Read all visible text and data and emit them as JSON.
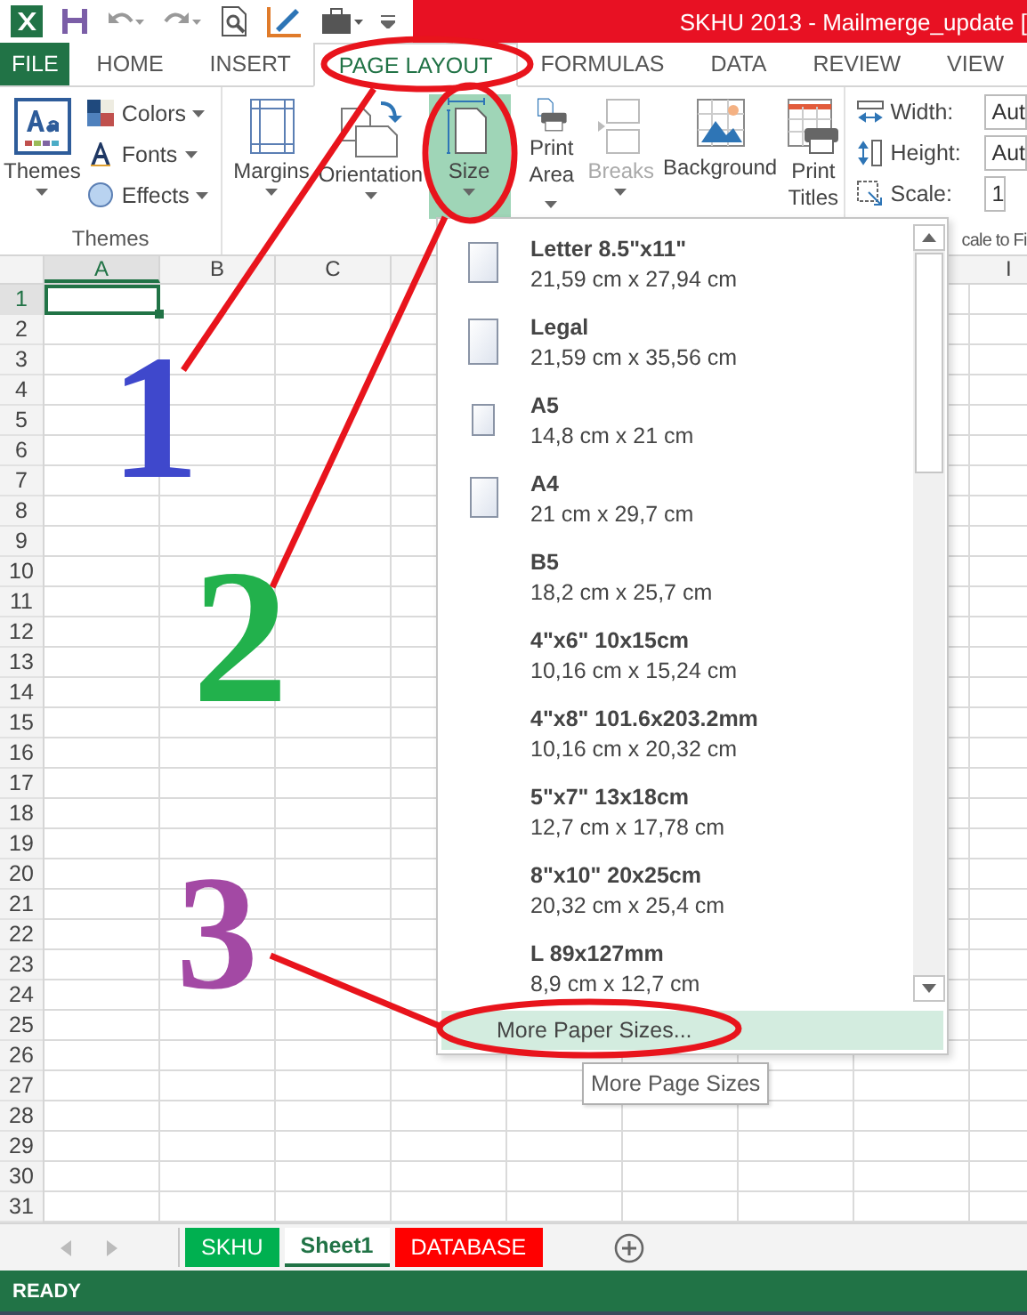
{
  "window": {
    "title": "SKHU 2013 - Mailmerge_update ["
  },
  "tabs": [
    {
      "label": "FILE",
      "kind": "file",
      "selected": false
    },
    {
      "label": "HOME",
      "kind": "tab",
      "selected": false
    },
    {
      "label": "INSERT",
      "kind": "tab",
      "selected": false
    },
    {
      "label": "PAGE LAYOUT",
      "kind": "tab",
      "selected": true
    },
    {
      "label": "FORMULAS",
      "kind": "tab",
      "selected": false
    },
    {
      "label": "DATA",
      "kind": "tab",
      "selected": false
    },
    {
      "label": "REVIEW",
      "kind": "tab",
      "selected": false
    },
    {
      "label": "VIEW",
      "kind": "tab",
      "selected": false
    }
  ],
  "ribbon": {
    "themes_group": {
      "title": "Themes",
      "big_button": {
        "label": "Themes"
      },
      "small_buttons": [
        {
          "label": "Colors"
        },
        {
          "label": "Fonts"
        },
        {
          "label": "Effects"
        }
      ]
    },
    "page_setup_buttons": [
      {
        "label": "Margins",
        "selected": false,
        "disabled": false
      },
      {
        "label": "Orientation",
        "selected": false,
        "disabled": false
      },
      {
        "label": "Size",
        "selected": true,
        "disabled": false
      },
      {
        "label": "Print Area",
        "selected": false,
        "disabled": false
      },
      {
        "label": "Breaks",
        "selected": false,
        "disabled": true
      },
      {
        "label": "Background",
        "selected": false,
        "disabled": false
      },
      {
        "label": "Print Titles",
        "selected": false,
        "disabled": false
      }
    ],
    "scale_group": {
      "title": "cale to Fi",
      "rows": [
        {
          "label": "Width:",
          "value": "Aut"
        },
        {
          "label": "Height:",
          "value": "Aut"
        },
        {
          "label": "Scale:",
          "value": "1"
        }
      ]
    }
  },
  "sheet": {
    "columns": [
      {
        "label": "A",
        "selected": true
      },
      {
        "label": "B",
        "selected": false
      },
      {
        "label": "C",
        "selected": false
      },
      {
        "label": "I",
        "selected": false
      }
    ],
    "rows": [
      {
        "label": "1",
        "selected": true
      },
      {
        "label": "2",
        "selected": false
      },
      {
        "label": "3",
        "selected": false
      },
      {
        "label": "4",
        "selected": false
      },
      {
        "label": "5",
        "selected": false
      },
      {
        "label": "6",
        "selected": false
      },
      {
        "label": "7",
        "selected": false
      },
      {
        "label": "8",
        "selected": false
      },
      {
        "label": "9",
        "selected": false
      },
      {
        "label": "10",
        "selected": false
      },
      {
        "label": "11",
        "selected": false
      },
      {
        "label": "12",
        "selected": false
      },
      {
        "label": "13",
        "selected": false
      },
      {
        "label": "14",
        "selected": false
      },
      {
        "label": "15",
        "selected": false
      },
      {
        "label": "16",
        "selected": false
      },
      {
        "label": "17",
        "selected": false
      },
      {
        "label": "18",
        "selected": false
      },
      {
        "label": "19",
        "selected": false
      },
      {
        "label": "20",
        "selected": false
      },
      {
        "label": "21",
        "selected": false
      },
      {
        "label": "22",
        "selected": false
      },
      {
        "label": "23",
        "selected": false
      },
      {
        "label": "24",
        "selected": false
      },
      {
        "label": "25",
        "selected": false
      },
      {
        "label": "26",
        "selected": false
      },
      {
        "label": "27",
        "selected": false
      },
      {
        "label": "28",
        "selected": false
      },
      {
        "label": "29",
        "selected": false
      },
      {
        "label": "30",
        "selected": false
      },
      {
        "label": "31",
        "selected": false
      }
    ]
  },
  "size_menu": {
    "items": [
      {
        "name": "Letter 8.5\"x11\"",
        "dimensions": "21,59 cm x 27,94 cm",
        "kind": "icon"
      },
      {
        "name": "Legal",
        "dimensions": "21,59 cm x 35,56 cm",
        "kind": "icon"
      },
      {
        "name": "A5",
        "dimensions": "14,8 cm x 21 cm",
        "kind": "icon"
      },
      {
        "name": "A4",
        "dimensions": "21 cm x 29,7 cm",
        "kind": "icon"
      },
      {
        "name": "B5",
        "dimensions": "18,2 cm x 25,7 cm",
        "kind": "text"
      },
      {
        "name": "4\"x6\" 10x15cm",
        "dimensions": "10,16 cm x 15,24 cm",
        "kind": "text"
      },
      {
        "name": "4\"x8\" 101.6x203.2mm",
        "dimensions": "10,16 cm x 20,32 cm",
        "kind": "text"
      },
      {
        "name": "5\"x7\" 13x18cm",
        "dimensions": "12,7 cm x 17,78 cm",
        "kind": "text"
      },
      {
        "name": "8\"x10\" 20x25cm",
        "dimensions": "20,32 cm x 25,4 cm",
        "kind": "text"
      },
      {
        "name": "L 89x127mm",
        "dimensions": "8,9 cm x 12,7 cm",
        "kind": "text"
      }
    ],
    "footer": {
      "label": "More Paper Sizes...",
      "selected": true
    },
    "tooltip": "More Page Sizes"
  },
  "sheet_tabs": [
    {
      "label": "SKHU",
      "color": "#00b050",
      "selected": false
    },
    {
      "label": "Sheet1",
      "selected": true
    },
    {
      "label": "DATABASE",
      "color": "#ff0000",
      "selected": false
    }
  ],
  "status_bar": {
    "text": "READY"
  },
  "annotations": [
    {
      "label": "1",
      "color": "#3f48cc"
    },
    {
      "label": "2",
      "color": "#22b14c"
    },
    {
      "label": "3",
      "color": "#a349a4"
    }
  ]
}
